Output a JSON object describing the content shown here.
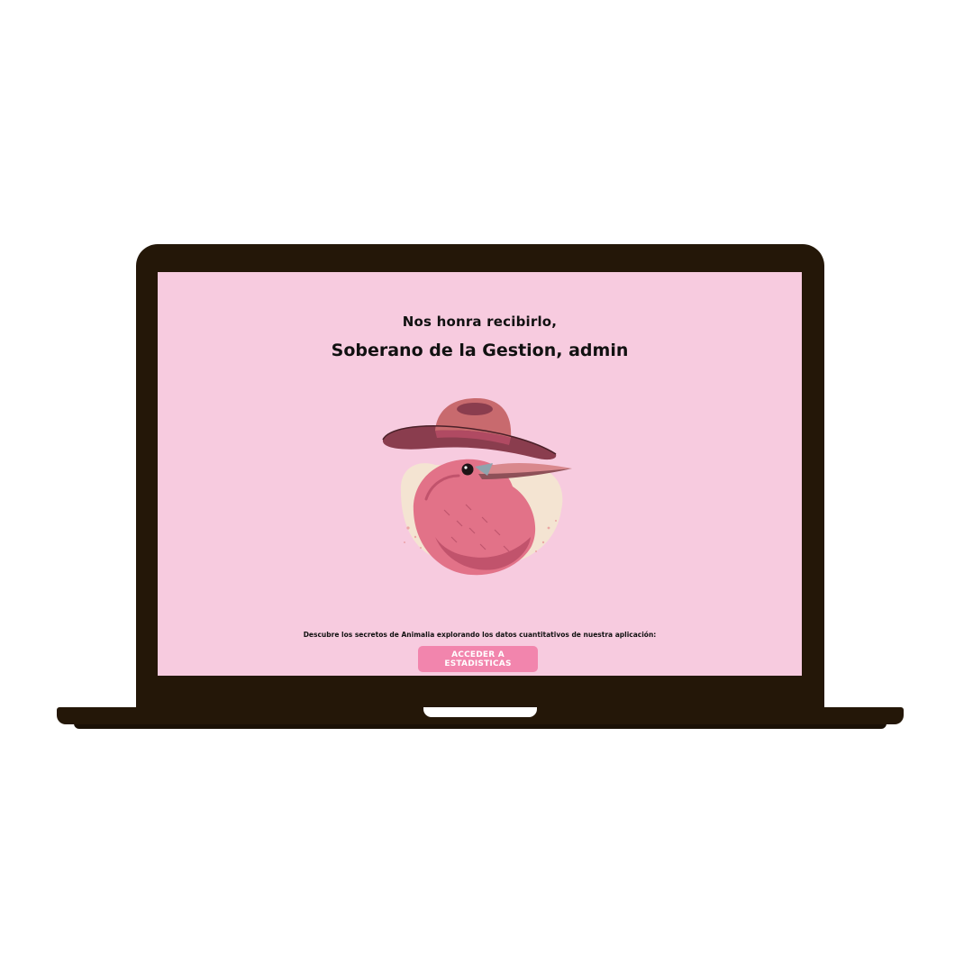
{
  "screen": {
    "greeting": "Nos honra recibirlo,",
    "title": "Soberano de la Gestion, admin",
    "mascot_icon": "bird-with-hat-illustration",
    "description": "Descubre los secretos de Animalia explorando los datos cuantitativos de nuestra aplicación:",
    "cta_label": "ACCEDER A ESTADISTICAS"
  },
  "colors": {
    "screen_background": "#f7cbdf",
    "button_background": "#f285ad",
    "laptop_frame": "#241708"
  }
}
